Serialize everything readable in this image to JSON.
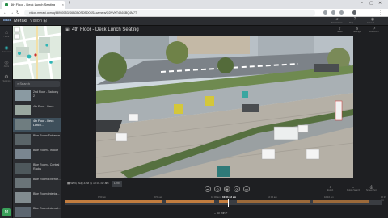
{
  "browser": {
    "tab_title": "4th Floor - Deck Lunch Seating",
    "tab_close": "×",
    "new_tab": "+",
    "url": "vision.meraki.com/q/68950053/S6BDB0SDBD0SS&camera/Q2NVKT4A6SBQ4M7T",
    "win_min": "–",
    "win_max": "▢",
    "win_close": "✕"
  },
  "app": {
    "logo": "cisco",
    "brand": "Meraki",
    "product": "Vision ⊞",
    "header_actions": [
      {
        "label": "Notifications",
        "icon": "bell-icon",
        "glyph": "♫"
      },
      {
        "label": "Help",
        "icon": "help-icon",
        "glyph": "?"
      },
      {
        "label": "Account",
        "icon": "user-icon",
        "glyph": "◉"
      }
    ]
  },
  "rail": {
    "items": [
      {
        "label": "Home",
        "glyph": "⌂",
        "icon": "home-icon"
      },
      {
        "label": "Cameras",
        "glyph": "◉",
        "icon": "camera-icon"
      },
      {
        "label": "Alerts",
        "glyph": "◎",
        "icon": "alert-icon"
      },
      {
        "label": "Settings",
        "glyph": "⚙",
        "icon": "gear-icon"
      }
    ],
    "bottom": "M"
  },
  "camlist": {
    "search_placeholder": "⌕ Search",
    "cameras": [
      {
        "name": "2nd Floor - Balcony 2"
      },
      {
        "name": "4th Floor - Deck"
      },
      {
        "name": "4th Floor - Deck Lunch..."
      },
      {
        "name": "Bike Room Entrance"
      },
      {
        "name": "Bike Room - Indoor"
      },
      {
        "name": "Bike Room - Central Racks"
      },
      {
        "name": "Bike Room Exterior..."
      },
      {
        "name": "Bike Room Interior..."
      },
      {
        "name": "Bike Room Internal..."
      }
    ]
  },
  "camera": {
    "title": "4th Floor - Deck Lunch Seating",
    "subtitle": "◷",
    "actions": [
      {
        "label": "Share",
        "glyph": "⇪",
        "icon": "share-icon"
      },
      {
        "label": "Settings",
        "glyph": "⚙",
        "icon": "gear-icon"
      },
      {
        "label": "Fullscreen",
        "glyph": "⤢",
        "icon": "fullscreen-icon"
      }
    ]
  },
  "playback": {
    "date": "▦ Wed, Aug 31st  ◷ 10:01:42 am",
    "live_badge": "LIVE",
    "current_time": "10:01:42 am",
    "zoom": "– 30 min +",
    "controls": [
      {
        "glyph": "⏮",
        "name": "skip-back-button"
      },
      {
        "glyph": "⟲",
        "name": "rewind-button"
      },
      {
        "glyph": "⏸",
        "name": "pause-button"
      },
      {
        "glyph": "⟳",
        "name": "forward-button"
      },
      {
        "glyph": "⏭",
        "name": "skip-forward-button"
      }
    ],
    "right_actions": [
      {
        "label": "Export",
        "glyph": "⇩",
        "icon": "export-icon"
      },
      {
        "label": "Motion Search",
        "glyph": "⌕",
        "icon": "motion-search-icon"
      },
      {
        "label": "Screenshot",
        "glyph": "⎙",
        "icon": "screenshot-icon"
      }
    ],
    "tick_labels": [
      "9:50 am",
      "9:55 am",
      "10:00 am",
      "10:05 am",
      "10:10 am",
      "10:15 am"
    ]
  }
}
